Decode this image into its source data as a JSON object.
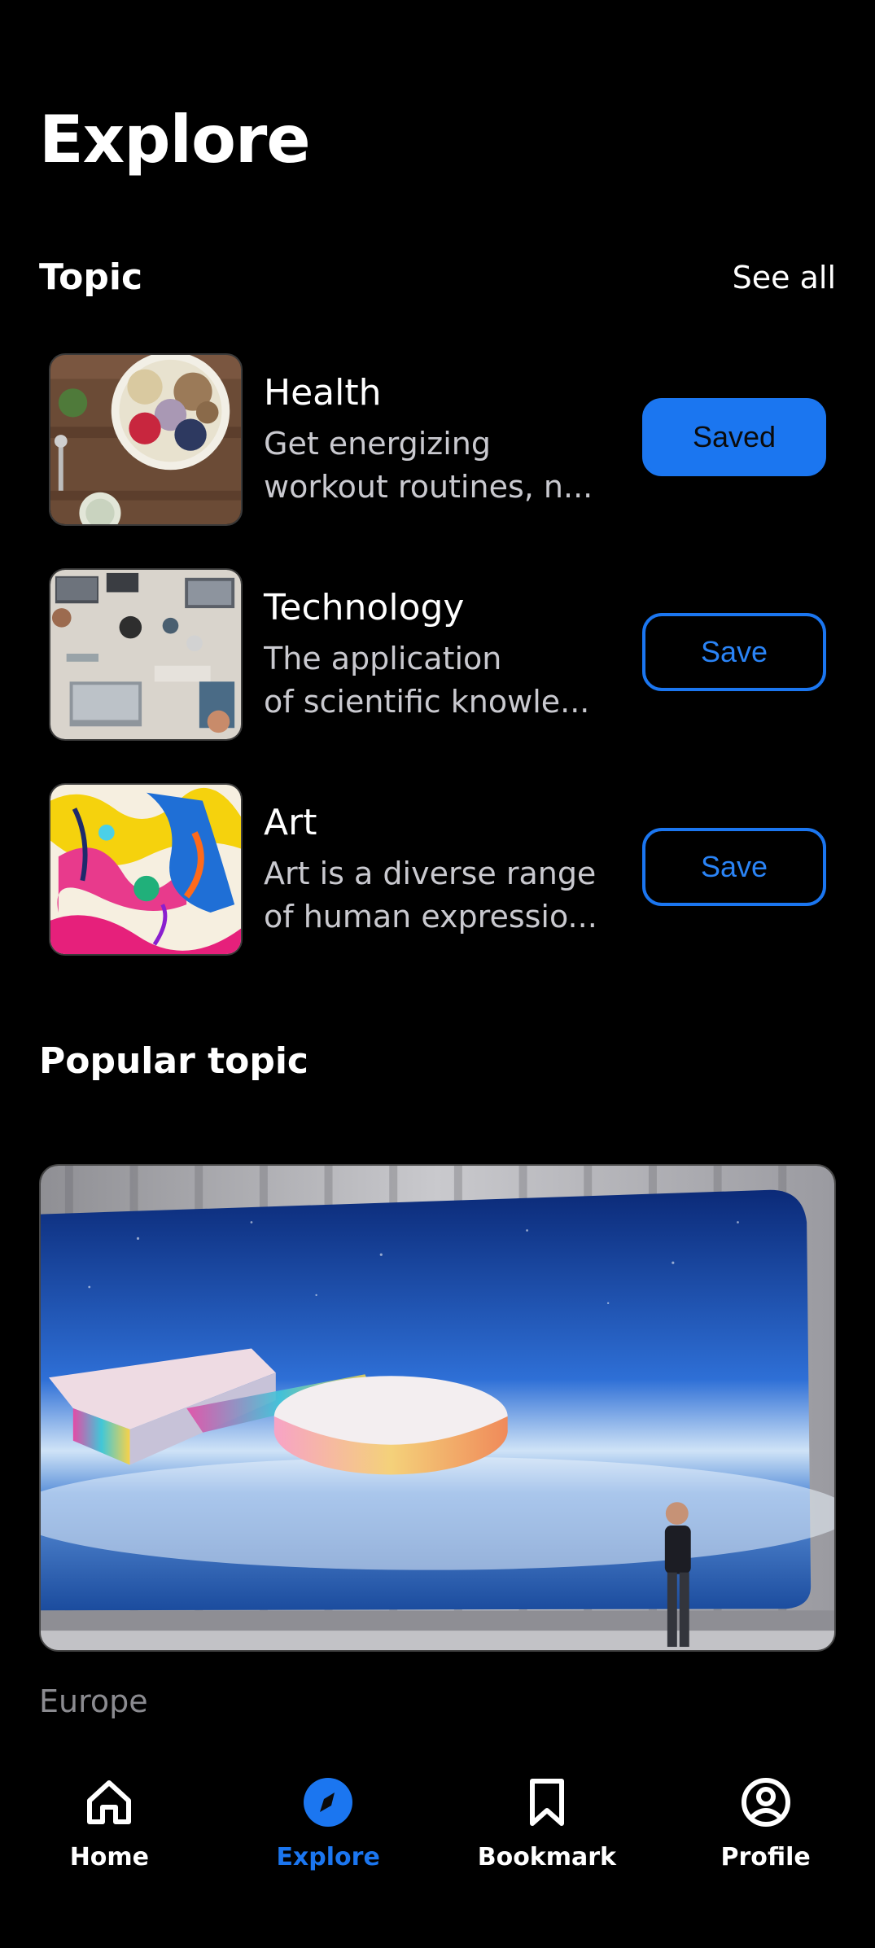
{
  "header": {
    "title": "Explore"
  },
  "topic_section": {
    "title": "Topic",
    "see_all": "See all",
    "items": [
      {
        "name": "Health",
        "desc_line1": "Get energizing",
        "desc_line2": "workout routines, n...",
        "button": "Saved"
      },
      {
        "name": "Technology",
        "desc_line1": "The application",
        "desc_line2": "of scientific knowle...",
        "button": "Save"
      },
      {
        "name": "Art",
        "desc_line1": "Art is a diverse range",
        "desc_line2": "of human expressio...",
        "button": "Save"
      }
    ]
  },
  "popular_section": {
    "title": "Popular topic",
    "card_caption": "Europe"
  },
  "nav": {
    "items": [
      {
        "label": "Home",
        "icon": "home-icon"
      },
      {
        "label": "Explore",
        "icon": "compass-icon"
      },
      {
        "label": "Bookmark",
        "icon": "bookmark-icon"
      },
      {
        "label": "Profile",
        "icon": "profile-icon"
      }
    ],
    "active": "Explore"
  },
  "colors": {
    "accent": "#1b76f0",
    "background": "#000000",
    "secondary_text": "#c9c9cf",
    "muted_text": "#8b8b90"
  }
}
